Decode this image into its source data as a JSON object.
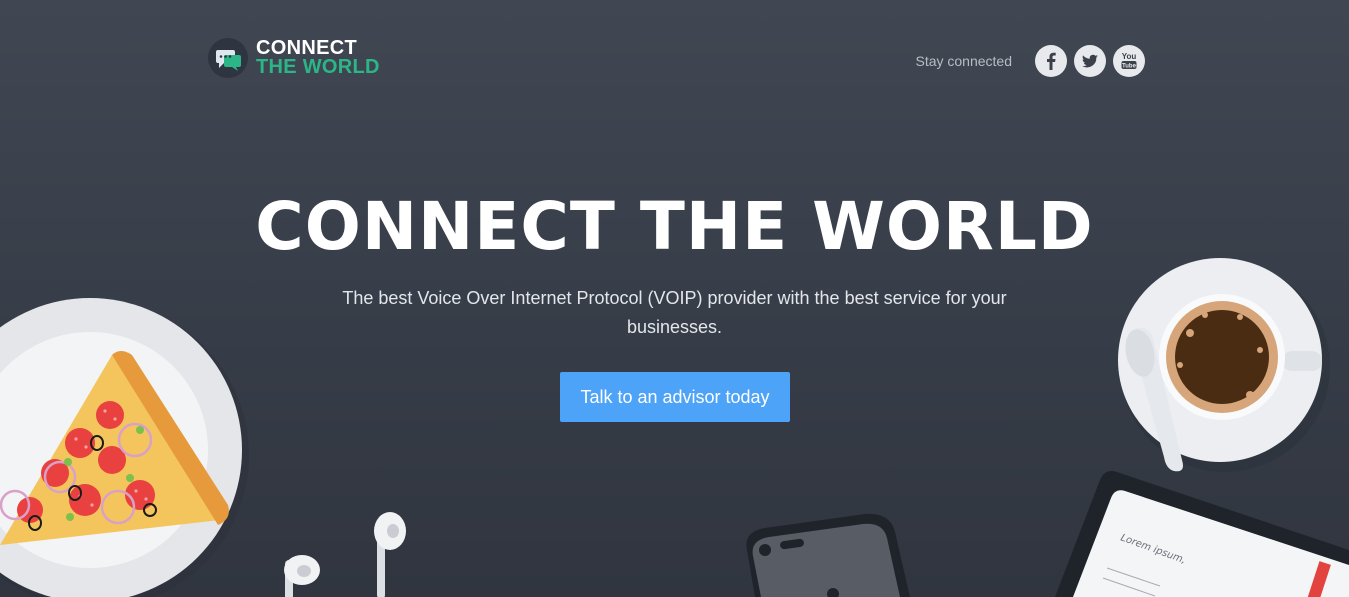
{
  "brand": {
    "line1": "CONNECT",
    "line2": "THE WORLD",
    "accent_color": "#2cb586"
  },
  "header": {
    "stay_connected": "Stay connected",
    "social": [
      {
        "name": "facebook-icon",
        "glyph": "f"
      },
      {
        "name": "twitter-icon",
        "glyph": "bird"
      },
      {
        "name": "youtube-icon",
        "glyph": "You Tube"
      }
    ]
  },
  "hero": {
    "title": "CONNECT THE WORLD",
    "subtitle": "The best Voice Over Internet Protocol (VOIP) provider with the best service for your businesses.",
    "cta_label": "Talk to an advisor today",
    "cta_color": "#4da3f7"
  },
  "decor": {
    "notebook_text": "Lorem ipsum,"
  }
}
